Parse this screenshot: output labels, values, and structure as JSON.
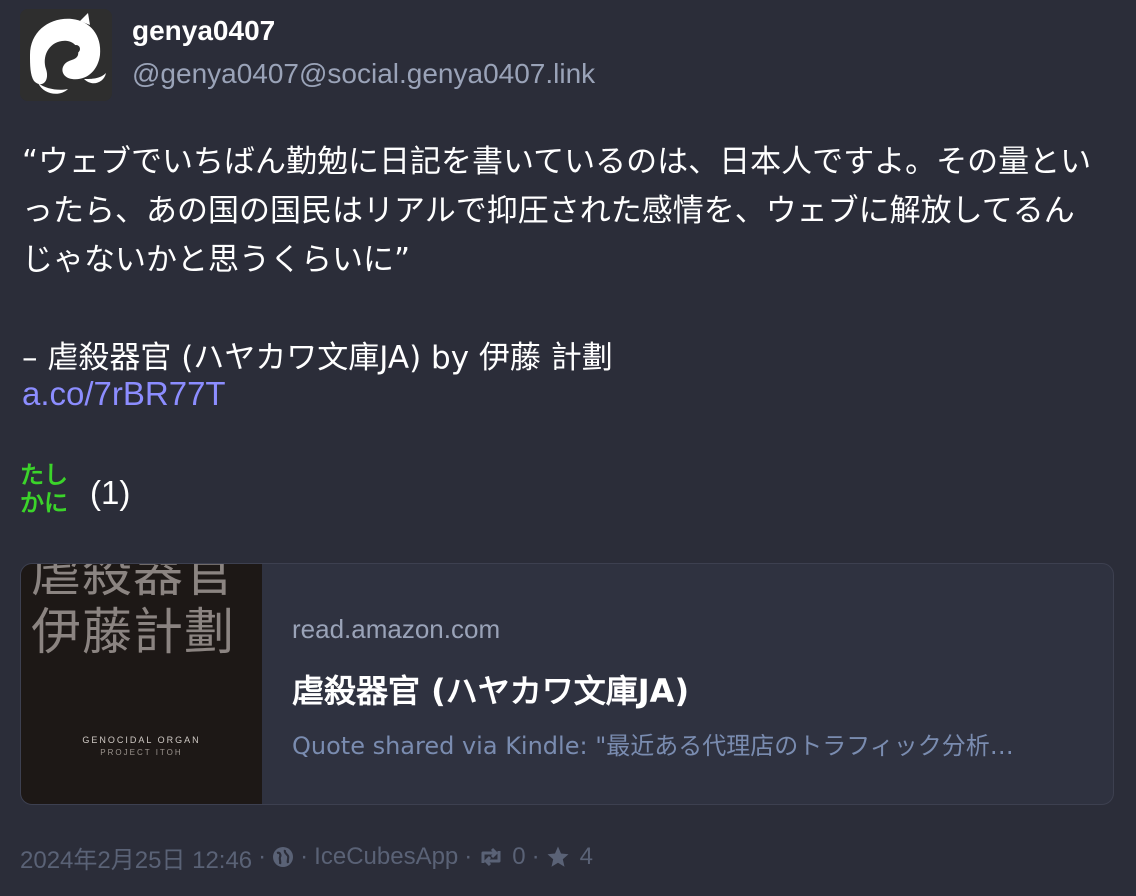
{
  "author": {
    "display_name": "genya0407",
    "handle": "@genya0407@social.genya0407.link"
  },
  "post": {
    "text": "“ウェブでいちばん勤勉に日記を書いているのは、日本人ですよ。その量といったら、あの国の国民はリアルで抑圧された感情を、ウェブに解放してるんじゃないかと思うくらいに”\n\n– 虐殺器官 (ハヤカワ文庫JA) by 伊藤 計劃",
    "link": "a.co/7rBR77T"
  },
  "reaction": {
    "emoji_text_line1": "たし",
    "emoji_text_line2": "かに",
    "count": "(1)",
    "emoji_color": "#3bd42a"
  },
  "card": {
    "cover_title": "虐殺器官",
    "cover_author": "伊藤計劃",
    "cover_en_title": "GENOCIDAL ORGAN",
    "cover_en_author": "PROJECT ITOH",
    "domain": "read.amazon.com",
    "title": "虐殺器官 (ハヤカワ文庫JA)",
    "description": "Quote shared via Kindle: \"最近ある代理店のトラフィック分析…"
  },
  "footer": {
    "timestamp": "2024年2月25日 12:46",
    "visibility_icon": "globe-icon",
    "app": "IceCubesApp",
    "boost_icon": "boost-icon",
    "boosts": "0",
    "favorite_icon": "star-icon",
    "favorites": "4"
  },
  "colors": {
    "background": "#2b2d39",
    "link": "#8c8dff",
    "muted": "#9aa3b8",
    "footer": "#5a6276"
  }
}
